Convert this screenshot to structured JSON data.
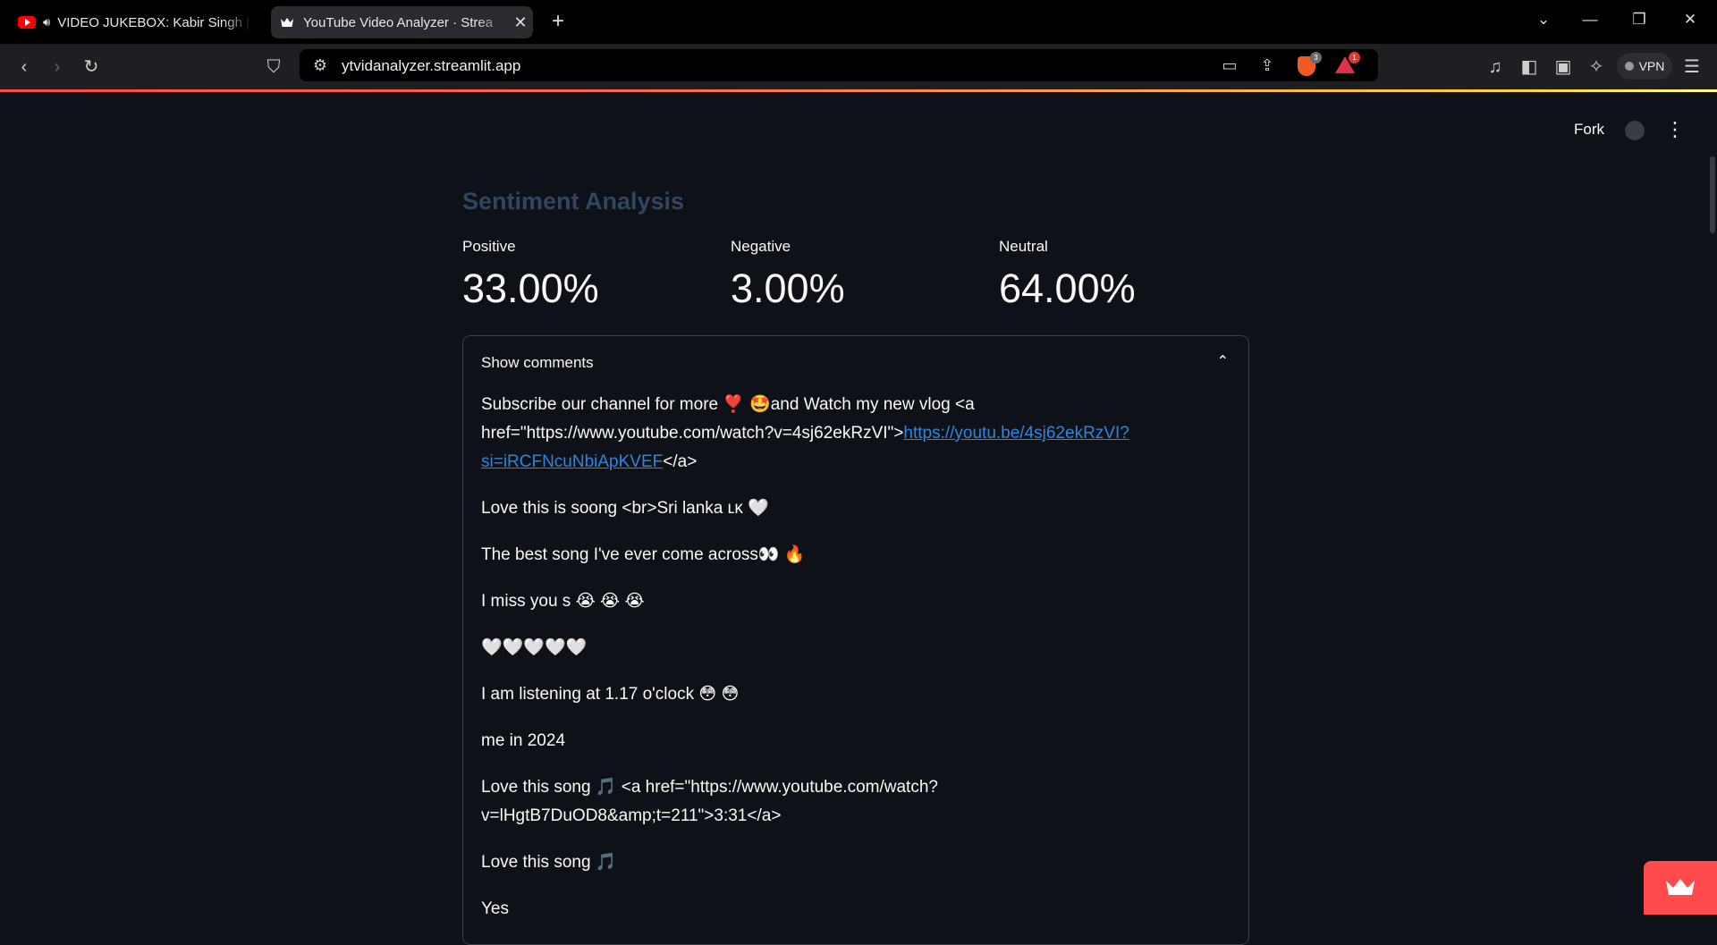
{
  "browser": {
    "tabs": [
      {
        "title": "VIDEO JUKEBOX: Kabir Singh | S",
        "icon": "youtube-icon",
        "audio_icon": "speaker-icon",
        "active": false
      },
      {
        "title": "YouTube Video Analyzer · Strea",
        "icon": "streamlit-crown-icon",
        "active": true
      }
    ],
    "new_tab": "+",
    "url": "ytvidanalyzer.streamlit.app",
    "shield_count": "3",
    "rewards_count": "1",
    "vpn_label": "VPN"
  },
  "app": {
    "fork_label": "Fork",
    "section_title": "Sentiment Analysis",
    "metrics": [
      {
        "label": "Positive",
        "value": "33.00%"
      },
      {
        "label": "Negative",
        "value": "3.00%"
      },
      {
        "label": "Neutral",
        "value": "64.00%"
      }
    ],
    "expander_label": "Show comments",
    "comments": {
      "c0_pre": "Subscribe our channel for more ",
      "c0_emoji": "❣️ 🤩",
      "c0_mid": "and Watch my new vlog <a href=\"https://www.youtube.com/watch?v=4sj62ekRzVI\">",
      "c0_link": "https://youtu.be/4sj62ekRzVI?si=iRCFNcuNbiApKVEF",
      "c0_post": "</a>",
      "c1": "Love this is soong <br>Sri lanka ʟᴋ 🤍",
      "c2": "The best song I've ever come across👀 🔥",
      "c3": "I miss you s 😭 😭 😭",
      "c4": "🤍🤍🤍🤍🤍",
      "c5": "I am listening at 1.17 o'clock 😳 😳",
      "c6": "me in 2024",
      "c7": "Love this song 🎵 <a href=\"https://www.youtube.com/watch?v=lHgtB7DuOD8&amp;t=211\">3:31</a>",
      "c8": "Love this song 🎵",
      "c9": "Yes"
    }
  },
  "colors": {
    "app_bg": "#0e1117",
    "accent": "#ff4b4b",
    "link": "#2b87e3",
    "title": "#31455e"
  }
}
